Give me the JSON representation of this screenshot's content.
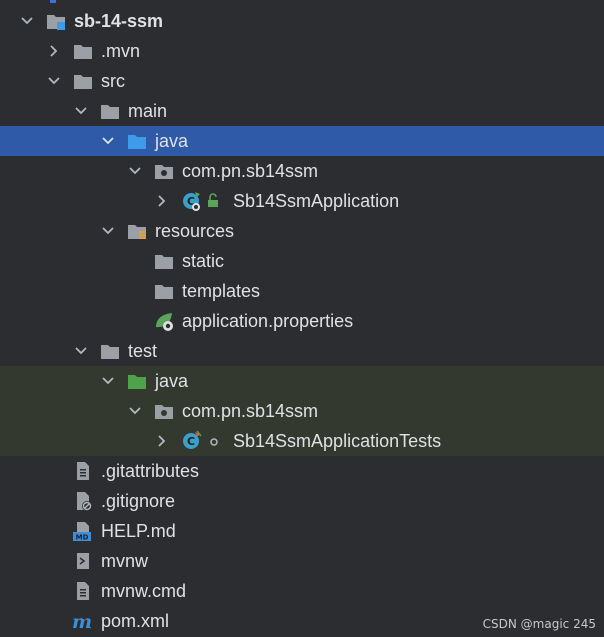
{
  "tree": {
    "root": {
      "label": "sb-14-ssm"
    },
    "mvn": {
      "label": ".mvn"
    },
    "src": {
      "label": "src"
    },
    "main": {
      "label": "main"
    },
    "main_java": {
      "label": "java"
    },
    "main_pkg": {
      "label": "com.pn.sb14ssm"
    },
    "app_class": {
      "label": "Sb14SsmApplication"
    },
    "resources": {
      "label": "resources"
    },
    "static": {
      "label": "static"
    },
    "templates": {
      "label": "templates"
    },
    "props": {
      "label": "application.properties"
    },
    "test": {
      "label": "test"
    },
    "test_java": {
      "label": "java"
    },
    "test_pkg": {
      "label": "com.pn.sb14ssm"
    },
    "test_class": {
      "label": "Sb14SsmApplicationTests"
    },
    "gitattributes": {
      "label": ".gitattributes"
    },
    "gitignore": {
      "label": ".gitignore"
    },
    "help": {
      "label": "HELP.md"
    },
    "mvnw": {
      "label": "mvnw"
    },
    "mvnwcmd": {
      "label": "mvnw.cmd"
    },
    "pom": {
      "label": "pom.xml"
    }
  },
  "watermark": "CSDN @magic 245",
  "colors": {
    "background": "#2b2d30",
    "selection": "#2e5aa7",
    "test_band": "#33392f",
    "folder": "#9aa0a6",
    "source_folder": "#3d9be9",
    "test_folder": "#4ea24a",
    "spring": "#5aa55a",
    "class": "#3aa0c8"
  }
}
